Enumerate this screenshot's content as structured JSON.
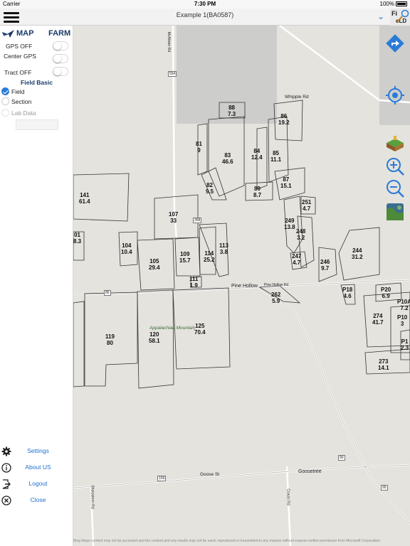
{
  "status_bar": {
    "carrier": "Carrier",
    "time": "7:30 PM",
    "battery": "100%"
  },
  "header": {
    "title": "Example 1(BA0587)",
    "logo_text": "FIELD"
  },
  "panel": {
    "brand_left": "MAP",
    "brand_right": "FARM",
    "toggles": [
      {
        "label": "GPS   OFF",
        "on": false
      },
      {
        "label": "Center GPS",
        "on": false
      },
      {
        "label": "Tract   OFF",
        "on": false
      }
    ],
    "section_title": "Field Basic",
    "options": [
      {
        "label": "Field",
        "selected": true
      },
      {
        "label": "Section",
        "selected": false
      },
      {
        "label": "Lab Data",
        "selected": false
      }
    ],
    "lab_value": "",
    "menu": [
      {
        "label": "Settings",
        "icon": "gear-icon"
      },
      {
        "label": "About US",
        "icon": "info-icon"
      },
      {
        "label": "Logout",
        "icon": "logout-icon"
      },
      {
        "label": "Close",
        "icon": "close-icon"
      }
    ]
  },
  "map": {
    "fields": [
      {
        "id": "88",
        "acres": "7.3"
      },
      {
        "id": "86",
        "acres": "19.2"
      },
      {
        "id": "81",
        "acres": "9"
      },
      {
        "id": "83",
        "acres": "46.6"
      },
      {
        "id": "84",
        "acres": "12.4"
      },
      {
        "id": "85",
        "acres": "11.1"
      },
      {
        "id": "82",
        "acres": "9.5"
      },
      {
        "id": "89",
        "acres": "8.7"
      },
      {
        "id": "87",
        "acres": "15.1"
      },
      {
        "id": "141",
        "acres": "61.4"
      },
      {
        "id": "251",
        "acres": "4.7"
      },
      {
        "id": "107",
        "acres": "33"
      },
      {
        "id": "249",
        "acres": "13.8"
      },
      {
        "id": "01",
        "acres": "8.3"
      },
      {
        "id": "248",
        "acres": "3.2"
      },
      {
        "id": "104",
        "acres": "10.4"
      },
      {
        "id": "113",
        "acres": "3.8"
      },
      {
        "id": "109",
        "acres": "15.7"
      },
      {
        "id": "114",
        "acres": "25.2"
      },
      {
        "id": "105",
        "acres": "29.4"
      },
      {
        "id": "244",
        "acres": "31.2"
      },
      {
        "id": "247",
        "acres": "4.7"
      },
      {
        "id": "246",
        "acres": "9.7"
      },
      {
        "id": "111",
        "acres": "1.9"
      },
      {
        "id": "262",
        "acres": "5.9"
      },
      {
        "id": "P18",
        "acres": "4.6"
      },
      {
        "id": "P20",
        "acres": "6.9"
      },
      {
        "id": "P10A",
        "acres": "7.2"
      },
      {
        "id": "274",
        "acres": "41.7"
      },
      {
        "id": "P10",
        "acres": "3"
      },
      {
        "id": "119",
        "acres": "80"
      },
      {
        "id": "120",
        "acres": "58.1"
      },
      {
        "id": "125",
        "acres": "70.4"
      },
      {
        "id": "P1",
        "acres": "2.3"
      },
      {
        "id": "273",
        "acres": "14.1"
      }
    ],
    "roads": [
      "Whipple Rd",
      "Pine Hollow",
      "Pine Hollow Rd",
      "Goose St",
      "Goosetree",
      "Appalachian Mountain",
      "McAlister Rd",
      "Cowan Rd",
      "Sharpsteen Rd",
      "554",
      "358",
      "86",
      "90",
      "159",
      "90"
    ],
    "copyright": "Bing Maps content may not be accessed and the content and any results may not be used, reproduced or transmitted in any manner without express written permission from Microsoft Corporation."
  },
  "tools": [
    {
      "name": "navigate-icon"
    },
    {
      "name": "locate-icon"
    },
    {
      "name": "layers-icon"
    },
    {
      "name": "zoom-in-icon"
    },
    {
      "name": "zoom-out-icon"
    },
    {
      "name": "satellite-icon"
    }
  ],
  "colors": {
    "accent": "#2a7bd8",
    "brand": "#1a3a6b",
    "map_bg": "#e5e3de",
    "overlay": "#c9c9c9"
  }
}
